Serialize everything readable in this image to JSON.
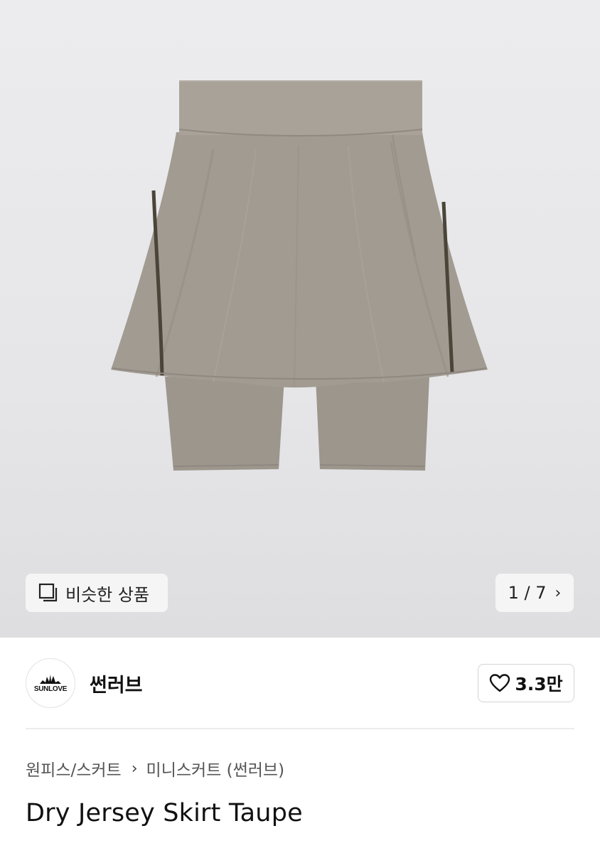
{
  "gallery": {
    "image_alt": "Dry Jersey Skirt Taupe product image",
    "similar_label": "비슷한 상품",
    "similar_icon": "copy-stack-icon",
    "counter": "1 / 7",
    "next_icon": "chevron-right-icon",
    "product_color": "#a19b92"
  },
  "brand": {
    "logo_text": "SUNLOVE",
    "name": "썬러브",
    "like_icon": "heart-outline-icon",
    "like_count": "3.3만"
  },
  "breadcrumb": {
    "category": "원피스/스커트",
    "separator_icon": "chevron-right-icon",
    "subcategory": "미니스커트 (썬러브)"
  },
  "product": {
    "title": "Dry Jersey Skirt Taupe"
  }
}
